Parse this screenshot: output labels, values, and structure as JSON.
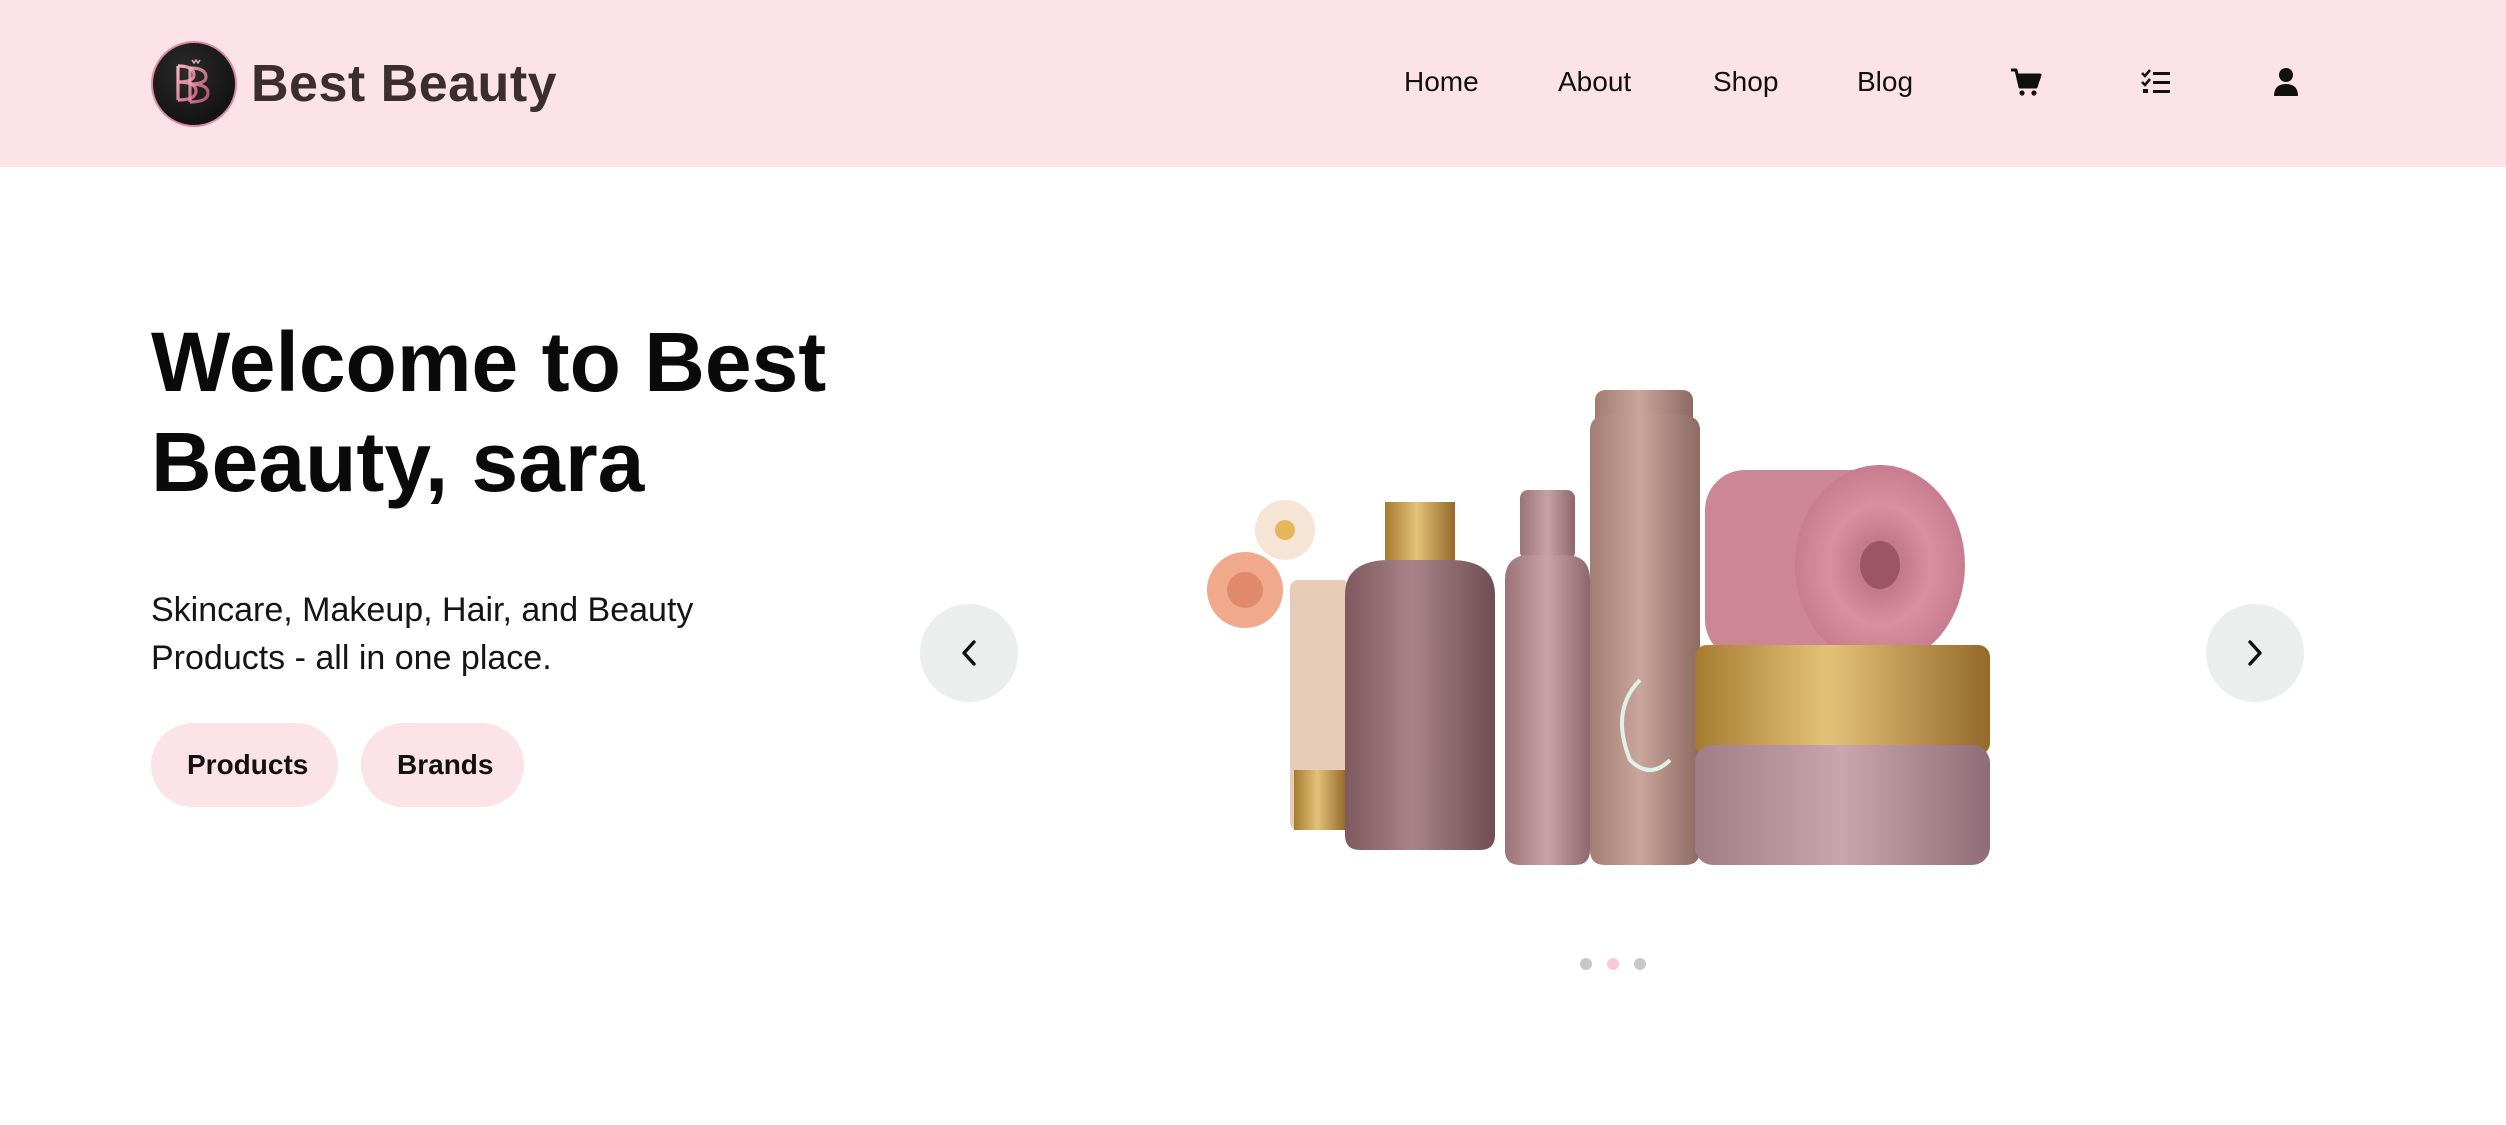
{
  "brand": {
    "name": "Best Beauty",
    "logo_text": "BB"
  },
  "nav": {
    "links": [
      "Home",
      "About",
      "Shop",
      "Blog"
    ],
    "icons": [
      "cart-icon",
      "checklist-icon",
      "user-icon"
    ]
  },
  "hero": {
    "title": "Welcome to Best Beauty, sara",
    "subtitle": "Skincare, Makeup, Hair, and Beauty Products - all in one place.",
    "buttons": [
      "Products",
      "Brands"
    ]
  },
  "carousel": {
    "prev_icon": "chevron-left-icon",
    "next_icon": "chevron-right-icon",
    "slide_count": 3,
    "active_slide": 2
  },
  "colors": {
    "header_bg": "#fce3e8",
    "pill_bg": "#fce3e8",
    "carousel_btn_bg": "#eceeed",
    "dot_active": "#f5c6d3",
    "dot_inactive": "#c4c4c4"
  }
}
